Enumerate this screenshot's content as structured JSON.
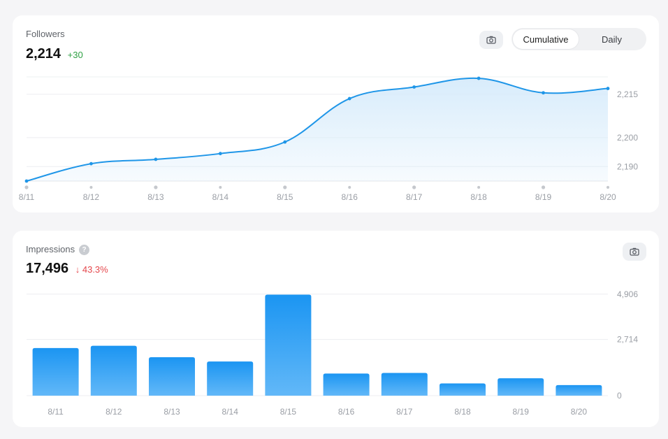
{
  "followers": {
    "title": "Followers",
    "value": "2,214",
    "delta": "+30",
    "toggle": {
      "options": [
        "Cumulative",
        "Daily"
      ],
      "active": "Cumulative"
    },
    "camera_icon": "camera-icon"
  },
  "impressions": {
    "title": "Impressions",
    "help_icon": "?",
    "value": "17,496",
    "delta_arrow": "↓",
    "delta": "43.3%",
    "camera_icon": "camera-icon"
  },
  "colors": {
    "line": "#1f96e8",
    "area": "#d6ebfb",
    "bar_top": "#1b95f2",
    "bar_bottom": "#62b8f8",
    "delta_up": "#2ea043",
    "delta_down": "#e5484d"
  },
  "chart_data": [
    {
      "type": "area",
      "categories": [
        "8/11",
        "8/12",
        "8/13",
        "8/14",
        "8/15",
        "8/16",
        "8/17",
        "8/18",
        "8/19",
        "8/20"
      ],
      "values": [
        2185,
        2191,
        2192.5,
        2194.5,
        2198.5,
        2213.5,
        2217.5,
        2220.5,
        2215.5,
        2217
      ],
      "y_ticks": [
        2190,
        2200,
        2215
      ],
      "y_tick_labels": [
        "2,190",
        "2,200",
        "2,215"
      ],
      "ylim": [
        2185,
        2221
      ],
      "grid": true
    },
    {
      "type": "bar",
      "categories": [
        "8/11",
        "8/12",
        "8/13",
        "8/14",
        "8/15",
        "8/16",
        "8/17",
        "8/18",
        "8/19",
        "8/20"
      ],
      "values": [
        2300,
        2410,
        1860,
        1650,
        4880,
        1070,
        1100,
        590,
        840,
        510
      ],
      "y_ticks": [
        0,
        2714,
        4906
      ],
      "y_tick_labels": [
        "0",
        "2,714",
        "4,906"
      ],
      "ylim": [
        0,
        5000
      ],
      "grid": true
    }
  ]
}
